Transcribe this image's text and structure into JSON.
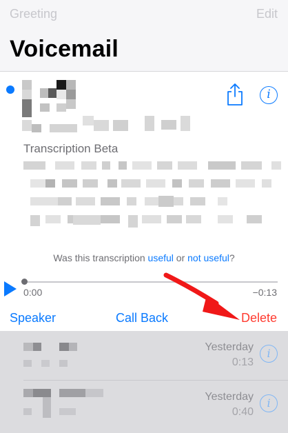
{
  "nav": {
    "back_label": "Greeting",
    "edit_label": "Edit"
  },
  "page": {
    "title": "Voicemail"
  },
  "voicemail": {
    "transcription_label": "Transcription Beta",
    "feedback": {
      "prefix": "Was this transcription ",
      "useful": "useful",
      "or": " or ",
      "not_useful": "not useful",
      "suffix": "?"
    },
    "player": {
      "elapsed": "0:00",
      "remaining": "−0:13",
      "progress": 0.0
    },
    "actions": {
      "speaker": "Speaker",
      "call_back": "Call Back",
      "delete": "Delete"
    }
  },
  "list": [
    {
      "date": "Yesterday",
      "duration": "0:13"
    },
    {
      "date": "Yesterday",
      "duration": "0:40"
    }
  ],
  "colors": {
    "accent": "#0a7aff",
    "destructive": "#ff3b30",
    "arrow": "#f01818"
  },
  "icons": {
    "share": "share-icon",
    "info": "info-icon",
    "play": "play-icon",
    "unread": "unread-dot-icon"
  }
}
